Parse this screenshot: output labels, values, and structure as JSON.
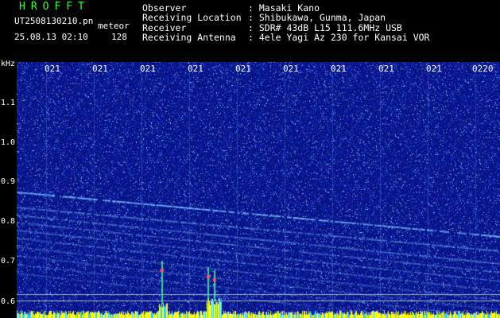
{
  "header": {
    "app_title": "HROFFT",
    "file_name": "UT2508130210.pn",
    "mode": "meteor",
    "datetime": "25.08.13 02:10",
    "count": "128"
  },
  "info": {
    "observer": {
      "key": "Observer",
      "value": ": Masaki Kano"
    },
    "location": {
      "key": "Receiving Location",
      "value": ": Shibukawa, Gunma, Japan"
    },
    "receiver": {
      "key": "Receiver",
      "value": ": SDR# 43dB L15 111.6MHz USB"
    },
    "antenna": {
      "key": "Receiving Antenna",
      "value": ": 4ele Yagi Az 230 for Kansai VOR"
    }
  },
  "axis": {
    "unit": "kHz",
    "y_ticks": [
      "1.1",
      "1.0",
      "0.9",
      "0.8",
      "0.7",
      "0.6"
    ],
    "time_ticks": [
      "021",
      "021",
      "021",
      "021",
      "021",
      "021",
      "021",
      "021",
      "021",
      "0220"
    ]
  },
  "colors": {
    "background": "#000000",
    "noise_base": "#0a1a8c",
    "trace": "#6fb7ff",
    "bottom_band": "#ffff00",
    "app_title": "#33ff33"
  }
}
